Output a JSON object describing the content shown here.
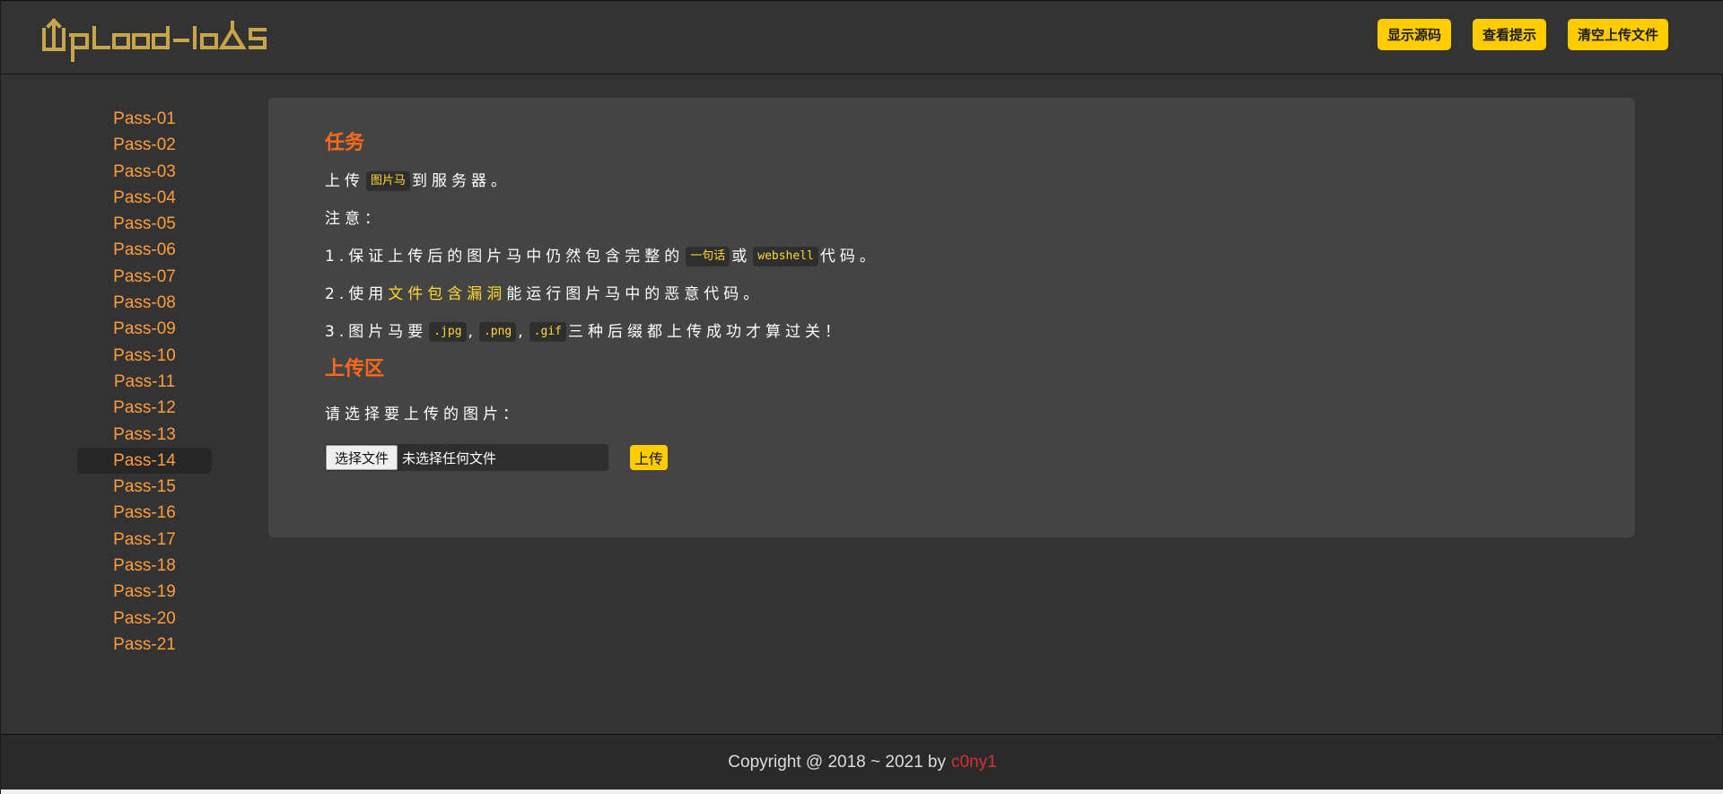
{
  "header": {
    "logo_text": "Upload-labs",
    "buttons": {
      "show_source": "显示源码",
      "view_hint": "查看提示",
      "clear_uploads": "清空上传文件"
    }
  },
  "sidebar": {
    "items": [
      {
        "label": "Pass-01"
      },
      {
        "label": "Pass-02"
      },
      {
        "label": "Pass-03"
      },
      {
        "label": "Pass-04"
      },
      {
        "label": "Pass-05"
      },
      {
        "label": "Pass-06"
      },
      {
        "label": "Pass-07"
      },
      {
        "label": "Pass-08"
      },
      {
        "label": "Pass-09"
      },
      {
        "label": "Pass-10"
      },
      {
        "label": "Pass-11"
      },
      {
        "label": "Pass-12"
      },
      {
        "label": "Pass-13"
      },
      {
        "label": "Pass-14"
      },
      {
        "label": "Pass-15"
      },
      {
        "label": "Pass-16"
      },
      {
        "label": "Pass-17"
      },
      {
        "label": "Pass-18"
      },
      {
        "label": "Pass-19"
      },
      {
        "label": "Pass-20"
      },
      {
        "label": "Pass-21"
      }
    ],
    "active_index": 13
  },
  "task": {
    "title": "任务",
    "line1": {
      "before": "上传",
      "code": "图片马",
      "after": "到服务器。"
    },
    "note_label": "注意：",
    "item1": {
      "before": "1.保证上传后的图片马中仍然包含完整的",
      "code1": "一句话",
      "middle": "或",
      "code2": "webshell",
      "after": "代码。"
    },
    "item2": {
      "before": "2.使用",
      "link": "文件包含漏洞",
      "after": "能运行图片马中的恶意代码。"
    },
    "item3": {
      "before": "3.图片马要",
      "code1": ".jpg",
      "sep1": ",",
      "code2": ".png",
      "sep2": ",",
      "code3": ".gif",
      "after": "三种后缀都上传成功才算过关！"
    }
  },
  "upload": {
    "title": "上传区",
    "prompt": "请选择要上传的图片：",
    "file_button": "选择文件",
    "file_status": "未选择任何文件",
    "submit": "上传"
  },
  "footer": {
    "copyright": "Copyright @ 2018 ~ 2021 by",
    "author": "c0ny1"
  },
  "colors": {
    "background": "#333333",
    "panel": "#444444",
    "accent_yellow": "#ffcc00",
    "title_orange": "#ff6a1a",
    "nav_orange": "#ff9d3c",
    "author_red": "#d63030"
  }
}
